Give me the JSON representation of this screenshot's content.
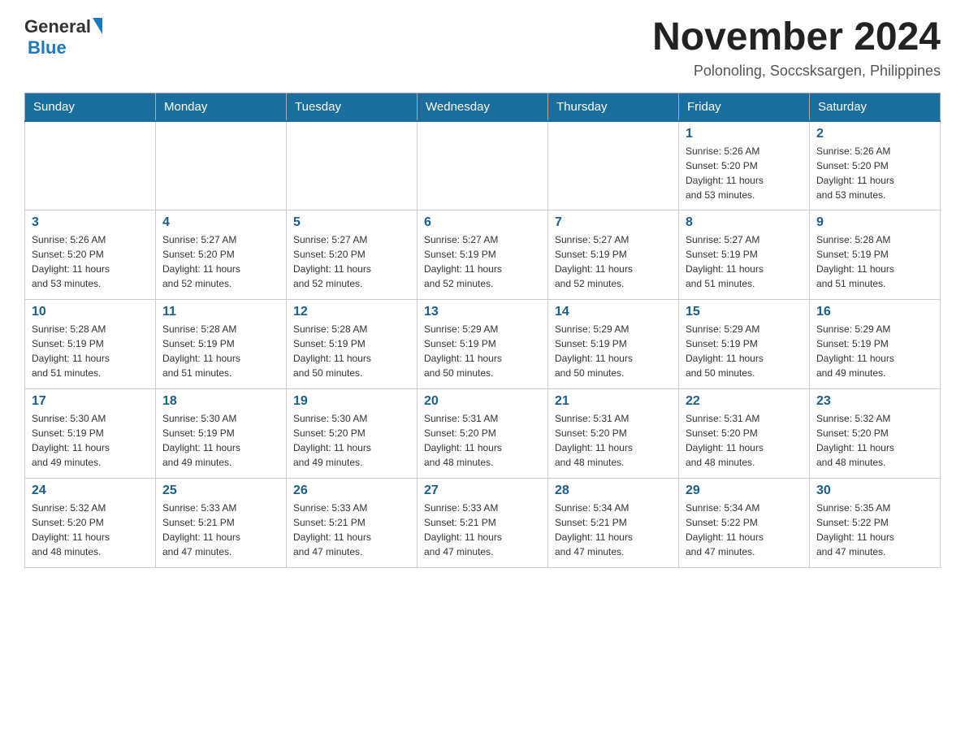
{
  "header": {
    "logo": {
      "general": "General",
      "blue": "Blue"
    },
    "month_title": "November 2024",
    "location": "Polonoling, Soccsksargen, Philippines"
  },
  "calendar": {
    "days_of_week": [
      "Sunday",
      "Monday",
      "Tuesday",
      "Wednesday",
      "Thursday",
      "Friday",
      "Saturday"
    ],
    "weeks": [
      [
        {
          "day": "",
          "info": ""
        },
        {
          "day": "",
          "info": ""
        },
        {
          "day": "",
          "info": ""
        },
        {
          "day": "",
          "info": ""
        },
        {
          "day": "",
          "info": ""
        },
        {
          "day": "1",
          "info": "Sunrise: 5:26 AM\nSunset: 5:20 PM\nDaylight: 11 hours\nand 53 minutes."
        },
        {
          "day": "2",
          "info": "Sunrise: 5:26 AM\nSunset: 5:20 PM\nDaylight: 11 hours\nand 53 minutes."
        }
      ],
      [
        {
          "day": "3",
          "info": "Sunrise: 5:26 AM\nSunset: 5:20 PM\nDaylight: 11 hours\nand 53 minutes."
        },
        {
          "day": "4",
          "info": "Sunrise: 5:27 AM\nSunset: 5:20 PM\nDaylight: 11 hours\nand 52 minutes."
        },
        {
          "day": "5",
          "info": "Sunrise: 5:27 AM\nSunset: 5:20 PM\nDaylight: 11 hours\nand 52 minutes."
        },
        {
          "day": "6",
          "info": "Sunrise: 5:27 AM\nSunset: 5:19 PM\nDaylight: 11 hours\nand 52 minutes."
        },
        {
          "day": "7",
          "info": "Sunrise: 5:27 AM\nSunset: 5:19 PM\nDaylight: 11 hours\nand 52 minutes."
        },
        {
          "day": "8",
          "info": "Sunrise: 5:27 AM\nSunset: 5:19 PM\nDaylight: 11 hours\nand 51 minutes."
        },
        {
          "day": "9",
          "info": "Sunrise: 5:28 AM\nSunset: 5:19 PM\nDaylight: 11 hours\nand 51 minutes."
        }
      ],
      [
        {
          "day": "10",
          "info": "Sunrise: 5:28 AM\nSunset: 5:19 PM\nDaylight: 11 hours\nand 51 minutes."
        },
        {
          "day": "11",
          "info": "Sunrise: 5:28 AM\nSunset: 5:19 PM\nDaylight: 11 hours\nand 51 minutes."
        },
        {
          "day": "12",
          "info": "Sunrise: 5:28 AM\nSunset: 5:19 PM\nDaylight: 11 hours\nand 50 minutes."
        },
        {
          "day": "13",
          "info": "Sunrise: 5:29 AM\nSunset: 5:19 PM\nDaylight: 11 hours\nand 50 minutes."
        },
        {
          "day": "14",
          "info": "Sunrise: 5:29 AM\nSunset: 5:19 PM\nDaylight: 11 hours\nand 50 minutes."
        },
        {
          "day": "15",
          "info": "Sunrise: 5:29 AM\nSunset: 5:19 PM\nDaylight: 11 hours\nand 50 minutes."
        },
        {
          "day": "16",
          "info": "Sunrise: 5:29 AM\nSunset: 5:19 PM\nDaylight: 11 hours\nand 49 minutes."
        }
      ],
      [
        {
          "day": "17",
          "info": "Sunrise: 5:30 AM\nSunset: 5:19 PM\nDaylight: 11 hours\nand 49 minutes."
        },
        {
          "day": "18",
          "info": "Sunrise: 5:30 AM\nSunset: 5:19 PM\nDaylight: 11 hours\nand 49 minutes."
        },
        {
          "day": "19",
          "info": "Sunrise: 5:30 AM\nSunset: 5:20 PM\nDaylight: 11 hours\nand 49 minutes."
        },
        {
          "day": "20",
          "info": "Sunrise: 5:31 AM\nSunset: 5:20 PM\nDaylight: 11 hours\nand 48 minutes."
        },
        {
          "day": "21",
          "info": "Sunrise: 5:31 AM\nSunset: 5:20 PM\nDaylight: 11 hours\nand 48 minutes."
        },
        {
          "day": "22",
          "info": "Sunrise: 5:31 AM\nSunset: 5:20 PM\nDaylight: 11 hours\nand 48 minutes."
        },
        {
          "day": "23",
          "info": "Sunrise: 5:32 AM\nSunset: 5:20 PM\nDaylight: 11 hours\nand 48 minutes."
        }
      ],
      [
        {
          "day": "24",
          "info": "Sunrise: 5:32 AM\nSunset: 5:20 PM\nDaylight: 11 hours\nand 48 minutes."
        },
        {
          "day": "25",
          "info": "Sunrise: 5:33 AM\nSunset: 5:21 PM\nDaylight: 11 hours\nand 47 minutes."
        },
        {
          "day": "26",
          "info": "Sunrise: 5:33 AM\nSunset: 5:21 PM\nDaylight: 11 hours\nand 47 minutes."
        },
        {
          "day": "27",
          "info": "Sunrise: 5:33 AM\nSunset: 5:21 PM\nDaylight: 11 hours\nand 47 minutes."
        },
        {
          "day": "28",
          "info": "Sunrise: 5:34 AM\nSunset: 5:21 PM\nDaylight: 11 hours\nand 47 minutes."
        },
        {
          "day": "29",
          "info": "Sunrise: 5:34 AM\nSunset: 5:22 PM\nDaylight: 11 hours\nand 47 minutes."
        },
        {
          "day": "30",
          "info": "Sunrise: 5:35 AM\nSunset: 5:22 PM\nDaylight: 11 hours\nand 47 minutes."
        }
      ]
    ]
  }
}
